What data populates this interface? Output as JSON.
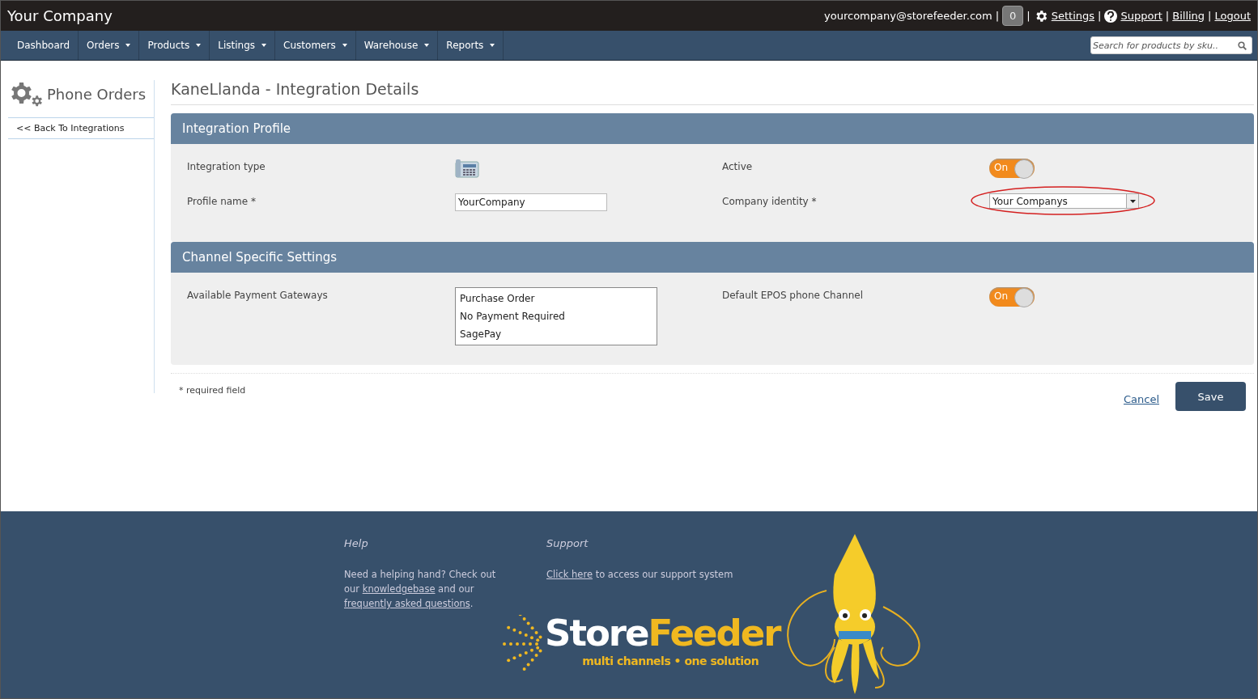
{
  "header": {
    "brand": "Your Company",
    "email": "yourcompany@storefeeder.com",
    "separator": "|",
    "notification_count": "0",
    "links": [
      "Settings",
      "Support",
      "Billing",
      "Logout"
    ]
  },
  "nav": {
    "items": [
      {
        "label": "Dashboard",
        "dropdown": false
      },
      {
        "label": "Orders",
        "dropdown": true
      },
      {
        "label": "Products",
        "dropdown": true
      },
      {
        "label": "Listings",
        "dropdown": true
      },
      {
        "label": "Customers",
        "dropdown": true
      },
      {
        "label": "Warehouse",
        "dropdown": true
      },
      {
        "label": "Reports",
        "dropdown": true
      }
    ],
    "search_placeholder": "Search for products by sku.."
  },
  "sidebar": {
    "title": "Phone Orders",
    "back_link": "<< Back To Integrations"
  },
  "page_title": "KaneLlanda - Integration Details",
  "sections": [
    {
      "title": "Integration Profile",
      "fields": [
        {
          "kind": "icon",
          "label": "Integration type"
        },
        {
          "kind": "toggle",
          "label": "Active",
          "on": true,
          "toggle_label": "On"
        },
        {
          "kind": "text",
          "label": "Profile name *",
          "value": "YourCompany"
        },
        {
          "kind": "select",
          "label": "Company identity *",
          "value": "Your Companys",
          "highlighted": true
        }
      ]
    },
    {
      "title": "Channel Specific Settings",
      "fields": [
        {
          "kind": "list",
          "label": "Available Payment Gateways",
          "options": [
            "Purchase Order",
            "No Payment Required",
            "SagePay"
          ]
        },
        {
          "kind": "toggle",
          "label": "Default EPOS phone Channel",
          "on": true,
          "toggle_label": "On"
        }
      ]
    }
  ],
  "required_note": "* required field",
  "actions": {
    "cancel": "Cancel",
    "save": "Save"
  },
  "footer": {
    "help": {
      "title": "Help",
      "text": [
        {
          "kind": "text",
          "text": "Need a helping hand? Check out our "
        },
        {
          "kind": "link",
          "text": "knowledgebase"
        },
        {
          "kind": "text",
          "text": " and our "
        },
        {
          "kind": "link",
          "text": "frequently asked questions"
        },
        {
          "kind": "text",
          "text": "."
        }
      ]
    },
    "support": {
      "title": "Support",
      "text": [
        {
          "kind": "link",
          "text": "Click here"
        },
        {
          "kind": "text",
          "text": " to access our support system"
        }
      ]
    },
    "logo": {
      "wordmark": [
        "Store",
        "Feeder"
      ],
      "tagline": "multi channels • one solution"
    }
  }
}
